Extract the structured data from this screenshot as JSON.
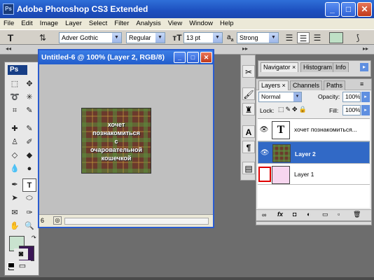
{
  "app": {
    "title": "Adobe Photoshop CS3 Extended",
    "icon_text": "Ps"
  },
  "window_buttons": {
    "minimize": "_",
    "maximize": "□",
    "close": "✕"
  },
  "menu": [
    "File",
    "Edit",
    "Image",
    "Layer",
    "Select",
    "Filter",
    "Analysis",
    "View",
    "Window",
    "Help"
  ],
  "options_bar": {
    "tool_icon": "T",
    "font_family": "Adver Gothic",
    "font_style": "Regular",
    "font_size": "13 pt",
    "aa_label": "a",
    "aa_sub": "a",
    "aa_mode": "Strong"
  },
  "toolbox": {
    "logo": "Ps"
  },
  "document": {
    "title": "Untitled-6 @ 100% (Layer 2, RGB/8)",
    "zoom_status": "6",
    "artwork_lines": [
      "хочет",
      "познакомиться",
      "с",
      "очаровательной",
      "кошечкой"
    ]
  },
  "navigator_panel": {
    "tabs": [
      "Navigator",
      "Histogram",
      "Info"
    ]
  },
  "layers_panel": {
    "tabs": [
      "Layers",
      "Channels",
      "Paths"
    ],
    "blend_mode": "Normal",
    "opacity_label": "Opacity:",
    "opacity_value": "100%",
    "lock_label": "Lock:",
    "fill_label": "Fill:",
    "fill_value": "100%",
    "layers": [
      {
        "name": "хочет познакомиться...",
        "thumb": "T",
        "selected": false
      },
      {
        "name": "Layer 2",
        "thumb": "",
        "selected": true
      },
      {
        "name": "Layer 1",
        "thumb": "",
        "selected": false
      }
    ]
  },
  "colors": {
    "foreground": "#c9e3cf",
    "background": "#3b1656",
    "selection": "#3169c6",
    "highlight_box": "#e00000"
  }
}
